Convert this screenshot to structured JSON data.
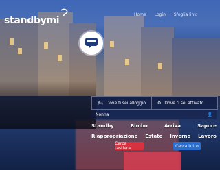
{
  "brand": {
    "name": "standbymi"
  },
  "nav": {
    "items": [
      "Home",
      "Login",
      "Sfoglia link"
    ]
  },
  "hero": {
    "badge_caption": ""
  },
  "search": {
    "segment1": "Dove ti sei alloggio",
    "segment2": "Dove ti sei attivato",
    "subrow_left": "Nonna",
    "subrow_right": ""
  },
  "categories": {
    "row1": [
      "Standby",
      "Bimbo",
      "Arriva",
      "Sapore"
    ],
    "row2": [
      "Riappropriazione",
      "Estate",
      "Inverno",
      "Lavoro"
    ]
  },
  "buttons": {
    "primary": "Cerca tastiera",
    "secondary": "Cerca tutto"
  },
  "colors": {
    "primary": "#d8313f",
    "secondary": "#2a6fd0"
  }
}
